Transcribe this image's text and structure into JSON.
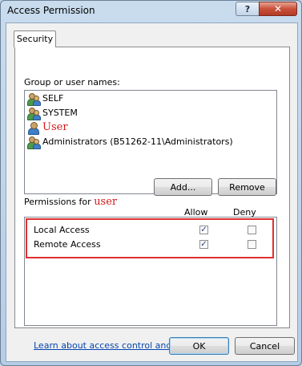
{
  "window": {
    "title": "Access Permission",
    "help_label": "?",
    "close_label": "✕"
  },
  "tabs": [
    {
      "label": "Security"
    }
  ],
  "group_label": "Group or user names:",
  "users": [
    {
      "name": "SELF",
      "icon": "group-icon"
    },
    {
      "name": "SYSTEM",
      "icon": "group-icon"
    },
    {
      "name": "User",
      "icon": "user-icon",
      "color": "#d01818"
    },
    {
      "name": "Administrators (B51262-11\\Administrators)",
      "icon": "group-icon"
    }
  ],
  "buttons": {
    "add": "Add...",
    "remove": "Remove",
    "ok": "OK",
    "cancel": "Cancel"
  },
  "permissions": {
    "label": "Permissions for",
    "target": "user",
    "allow_header": "Allow",
    "deny_header": "Deny",
    "rows": [
      {
        "label": "Local Access",
        "allow": true,
        "deny": false
      },
      {
        "label": "Remote Access",
        "allow": true,
        "deny": false
      }
    ]
  },
  "highlight_color": "#e03030",
  "link_text": "Learn about access control and permissions",
  "check_glyph": "✓"
}
